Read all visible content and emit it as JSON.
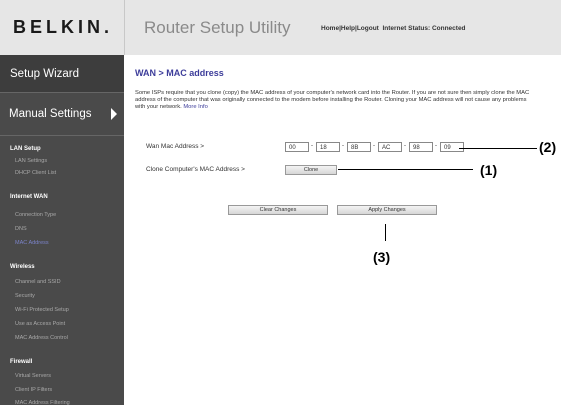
{
  "header": {
    "logo": "BELKIN.",
    "title": "Router Setup Utility",
    "links": [
      "Home",
      "Help",
      "Logout"
    ],
    "status": "Internet Status: Connected"
  },
  "sidebar": {
    "setup_wizard": "Setup Wizard",
    "manual_settings": "Manual Settings",
    "sections": [
      {
        "title": "LAN Setup",
        "items": [
          "LAN Settings",
          "DHCP Client List"
        ]
      },
      {
        "title": "Internet WAN",
        "items": [
          "Connection Type",
          "DNS",
          "MAC Address"
        ]
      },
      {
        "title": "Wireless",
        "items": [
          "Channel and SSID",
          "Security",
          "Wi-Fi Protected Setup",
          "Use as Access Point",
          "MAC Address Control"
        ]
      },
      {
        "title": "Firewall",
        "items": [
          "Virtual Servers",
          "Client IP Filters",
          "MAC Address Filtering"
        ]
      }
    ]
  },
  "main": {
    "title": "WAN > MAC address",
    "description": "Some ISPs require that you clone (copy) the MAC address of your computer's network card into the Router. If you are not sure then simply clone the MAC address of the computer that was originally connected to the modem before installing the Router. Cloning your MAC address will not cause any problems with your network.",
    "more_info": "More Info",
    "wan_mac_label": "Wan Mac Address >",
    "mac_octets": [
      "00",
      "18",
      "8B",
      "AC",
      "98",
      "09"
    ],
    "clone_label": "Clone Computer's MAC Address >",
    "clone_button": "Clone",
    "clear_button": "Clear Changes",
    "apply_button": "Apply Changes"
  },
  "annotations": {
    "a1": "(1)",
    "a2": "(2)",
    "a3": "(3)"
  }
}
